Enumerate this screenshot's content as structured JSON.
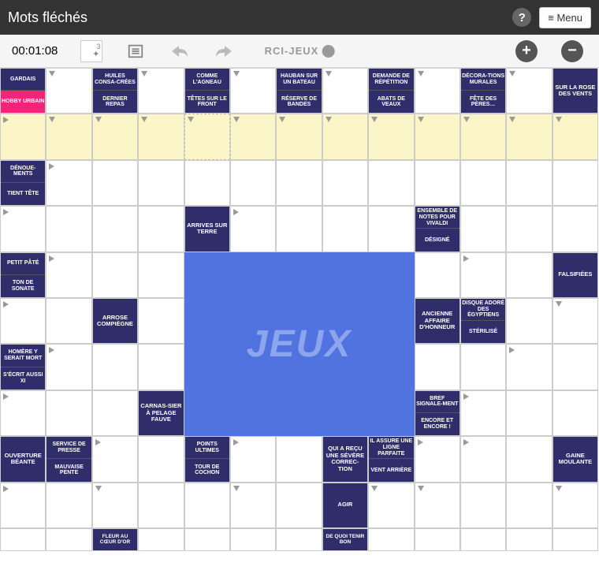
{
  "header": {
    "title": "Mots fléchés",
    "menu": "≡ Menu",
    "help": "?"
  },
  "toolbar": {
    "timer": "00:01:08",
    "hint": "3",
    "logo": "RCI-JEUX",
    "plus": "+",
    "minus": "−"
  },
  "ad": {
    "text": "JEUX"
  },
  "clues": {
    "c_0_0": "GARDAIS",
    "c_0_1": "HOBBY URBAIN",
    "c_0_2a": "HUILES CONSA-CRÉES",
    "c_0_2b": "DERNIER REPAS",
    "c_0_4a": "COMME L'AGNEAU",
    "c_0_4b": "TÊTES SUR LE FRONT",
    "c_0_6a": "HAUBAN SUR UN BATEAU",
    "c_0_6b": "RÉSERVE DE BANDES",
    "c_0_8a": "DEMANDE DE RÉPÉTITION",
    "c_0_8b": "ABATS DE VEAUX",
    "c_0_10a": "DÉCORA-TIONS MURALES",
    "c_0_10b": "FÊTE DES PÈRES…",
    "c_0_12": "SUR LA ROSE DES VENTS",
    "c_2_0a": "DÉNOUE-MENTS",
    "c_2_0b": "TIENT TÊTE",
    "c_3_4": "ARRIVES SUR TERRE",
    "c_3_9a": "ENSEMBLE DE NOTES POUR VIVALDI",
    "c_3_9b": "DÉSIGNÉ",
    "c_4_0a": "PETIT PÂTÉ",
    "c_4_0b": "TON DE SONATE",
    "c_4_12": "FALSIFIÉES",
    "c_5_2": "ARROSE COMPIÈGNE",
    "c_5_9": "ANCIENNE AFFAIRE D'HONNEUR",
    "c_5_10a": "DISQUE ADORÉ DES ÉGYPTIENS",
    "c_5_10b": "STÉRILISÉ",
    "c_6_0a": "HOMÈRE Y SERAIT MORT",
    "c_6_0b": "S'ÉCRIT AUSSI XI",
    "c_7_3": "CARNAS-SIER À PELAGE FAUVE",
    "c_7_9a": "BREF SIGNALE-MENT",
    "c_7_9b": "ENCORE ET ENCORE !",
    "c_8_0": "OUVERTURE BÉANTE",
    "c_8_1a": "SERVICE DE PRESSE",
    "c_8_1b": "MAUVAISE PENTE",
    "c_8_4a": "POINTS ULTIMES",
    "c_8_4b": "TOUR DE COCHON",
    "c_8_7": "QUI A REÇU UNE SÉVÈRE CORREC-TION",
    "c_8_8a": "IL ASSURE UNE LIGNE PARFAITE",
    "c_8_8b": "VENT ARRIÈRE",
    "c_8_12": "GAINE MOULANTE",
    "c_9_7": "AGIR",
    "c_10_2": "FLEUR AU CŒUR D'OR",
    "c_10_7": "DE QUOI TENIR BON"
  }
}
